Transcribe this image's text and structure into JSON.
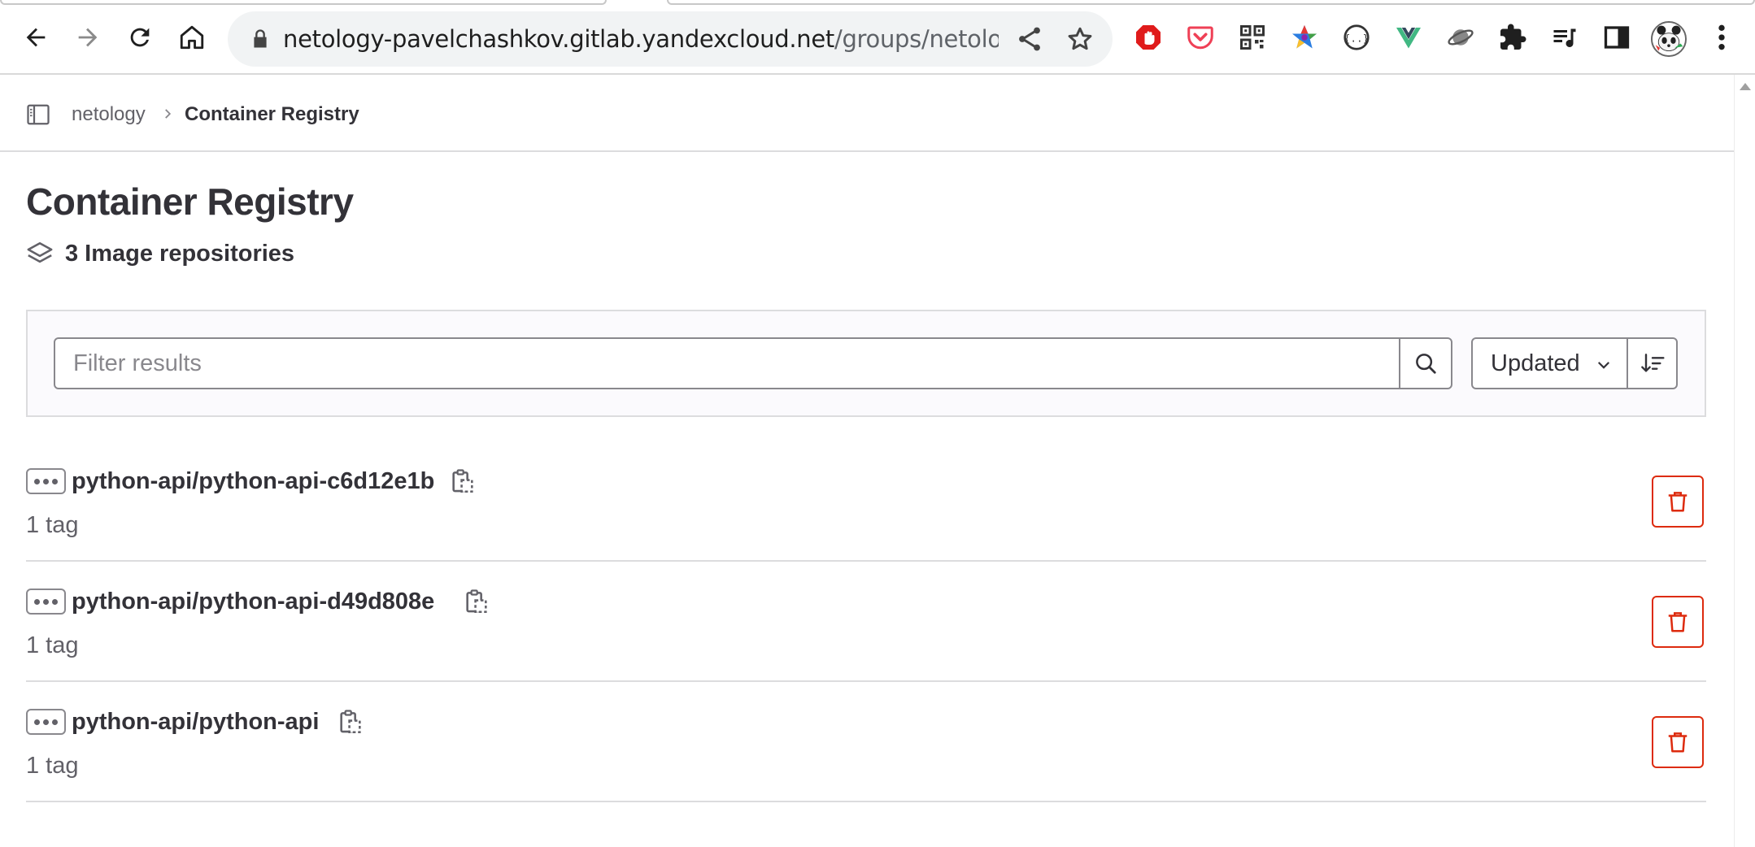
{
  "browser": {
    "url_host": "netology-pavelchashkov.gitlab.yandexcloud.net",
    "url_path": "/groups/netology/-...",
    "extensions": [
      "adblock-icon",
      "pocket-icon",
      "qr-code-icon",
      "color-star-icon",
      "json-viewer-icon",
      "vue-devtools-icon",
      "planet-icon",
      "puzzle-extensions-icon",
      "media-playlist-icon",
      "side-panel-icon"
    ]
  },
  "breadcrumb": {
    "group": "netology",
    "current": "Container Registry"
  },
  "page": {
    "title": "Container Registry",
    "repo_count": "3 Image repositories"
  },
  "filter": {
    "placeholder": "Filter results",
    "sort_label": "Updated"
  },
  "repositories": [
    {
      "name": "python-api/python-api-c6d12e1b",
      "tags": "1 tag"
    },
    {
      "name": "python-api/python-api-d49d808e",
      "tags": "1 tag"
    },
    {
      "name": "python-api/python-api",
      "tags": "1 tag"
    }
  ],
  "colors": {
    "danger": "#dd2b0e",
    "text": "#333238",
    "muted": "#626168",
    "border": "#dcdcde"
  }
}
